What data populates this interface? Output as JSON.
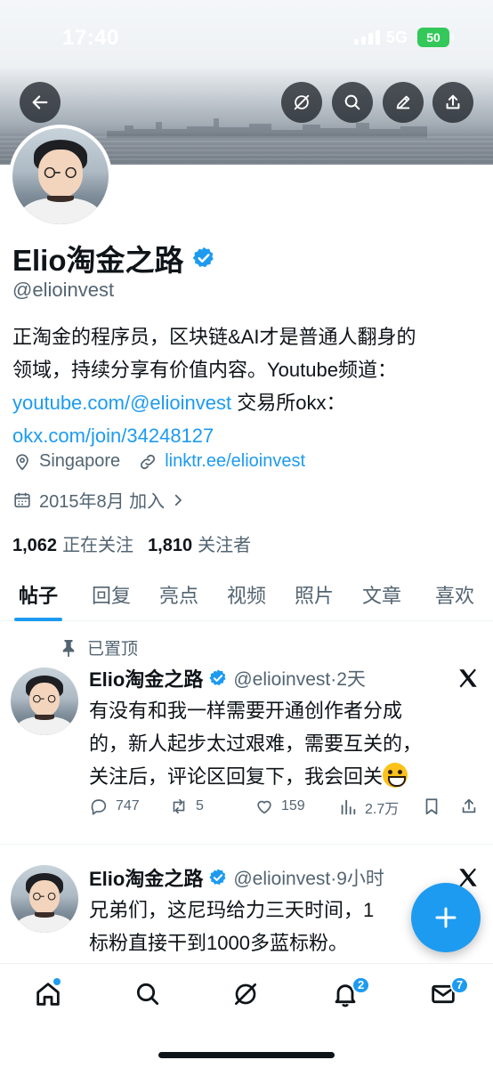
{
  "status_bar": {
    "time": "17:40",
    "network": "5G",
    "battery": "50"
  },
  "header": {
    "back": "arrow-left-icon",
    "actions": [
      "grok-icon",
      "search-icon",
      "edit-icon",
      "share-icon"
    ]
  },
  "profile": {
    "name": "Elio淘金之路",
    "handle": "@elioinvest",
    "bio_lines": [
      "正淘金的程序员，区块链&AI才是普通人翻身的",
      "领域，持续分享有价值内容。Youtube频道："
    ],
    "bio_link1": "youtube.com/@elioinvest",
    "bio_after_link1": " 交易所okx：",
    "bio_link2": "okx.com/join/34248127",
    "location": "Singapore",
    "website": "linktr.ee/elioinvest",
    "joined": "2015年8月 加入",
    "following_count": "1,062",
    "following_label": "正在关注",
    "followers_count": "1,810",
    "followers_label": "关注者"
  },
  "tabs": [
    {
      "label": "帖子",
      "active": true
    },
    {
      "label": "回复"
    },
    {
      "label": "亮点"
    },
    {
      "label": "视频"
    },
    {
      "label": "照片"
    },
    {
      "label": "文章"
    },
    {
      "label": "喜欢"
    }
  ],
  "tweets": [
    {
      "pinned_label": "已置顶",
      "name": "Elio淘金之路",
      "meta": "@elioinvest·2天",
      "lines": [
        "有没有和我一样需要开通创作者分成",
        "的，新人起步太过艰难，需要互关的，",
        "关注后，评论区回复下，我会回关"
      ],
      "replies": "747",
      "reposts": "5",
      "likes": "159",
      "views": "2.7万"
    },
    {
      "name": "Elio淘金之路",
      "meta": "@elioinvest·9小时",
      "lines": [
        "兄弟们，这尼玛给力三天时间，1",
        "标粉直接干到1000多蓝标粉。"
      ]
    }
  ],
  "bottom_nav": {
    "items": [
      "home-icon",
      "search-icon",
      "grok-icon",
      "bell-icon",
      "mail-icon"
    ],
    "notifications_badge": "2",
    "messages_badge": "7"
  },
  "colors": {
    "accent": "#1d9bf0",
    "text": "#0f1419",
    "secondary": "#536471"
  }
}
